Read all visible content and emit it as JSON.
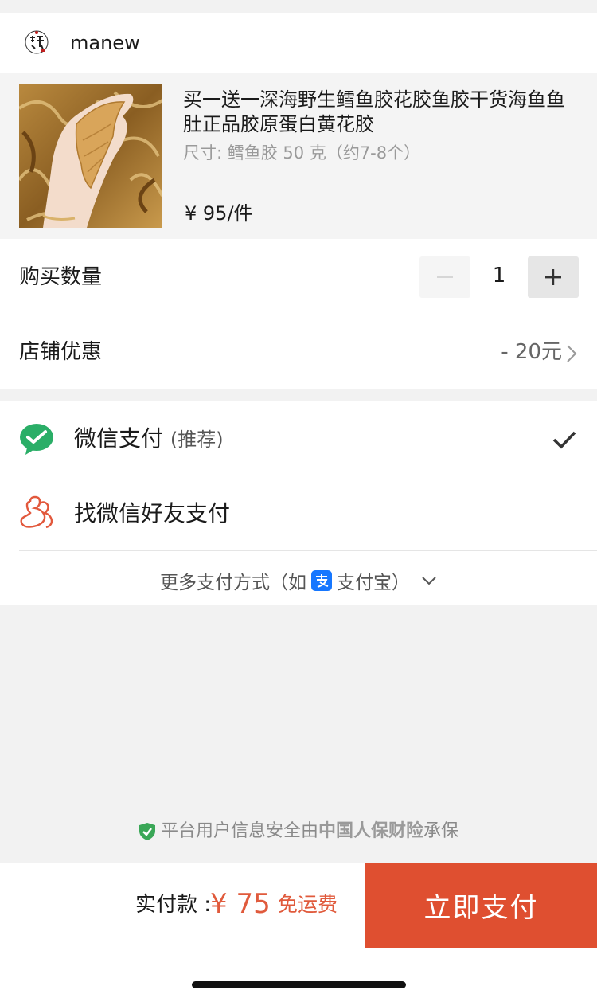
{
  "store": {
    "name": "manew",
    "logo_icon": "store-seal-logo"
  },
  "product": {
    "title": "买一送一深海野生鳕鱼胶花胶鱼胶干货海鱼鱼肚正品胶原蛋白黄花胶",
    "spec": "尺寸: 鳕鱼胶 50 克（约7-8个）",
    "price": "¥ 95/件"
  },
  "quantity": {
    "label": "购买数量",
    "value": "1",
    "minus_icon": "minus-icon",
    "plus_icon": "plus-icon"
  },
  "discount": {
    "label": "店铺优惠",
    "value": "- 20元",
    "icon": "chevron-right-icon"
  },
  "payment": {
    "wechat": {
      "label": "微信支付",
      "hint": "(推荐)",
      "icon": "wechat-pay-icon",
      "selected": true
    },
    "friend": {
      "label": "找微信好友支付",
      "icon": "friend-pay-icon"
    },
    "more": {
      "prefix": "更多支付方式（如",
      "alipay_icon": "alipay-icon",
      "suffix": "支付宝）",
      "chevron": "chevron-down-icon"
    }
  },
  "security": {
    "prefix": "平台用户信息安全由",
    "insurer": "中国人保财险",
    "suffix": "承保",
    "icon": "shield-check-icon"
  },
  "checkout": {
    "total_label": "实付款 :",
    "total_amount": "¥ 75",
    "shipping": "免运费",
    "pay_button": "立即支付"
  },
  "colors": {
    "accent": "#df4f30",
    "price": "#e05a3c",
    "wechat_green": "#2aae67",
    "alipay_blue": "#1677ff",
    "friend_orange": "#e2583c",
    "shield_green": "#3aa757"
  }
}
